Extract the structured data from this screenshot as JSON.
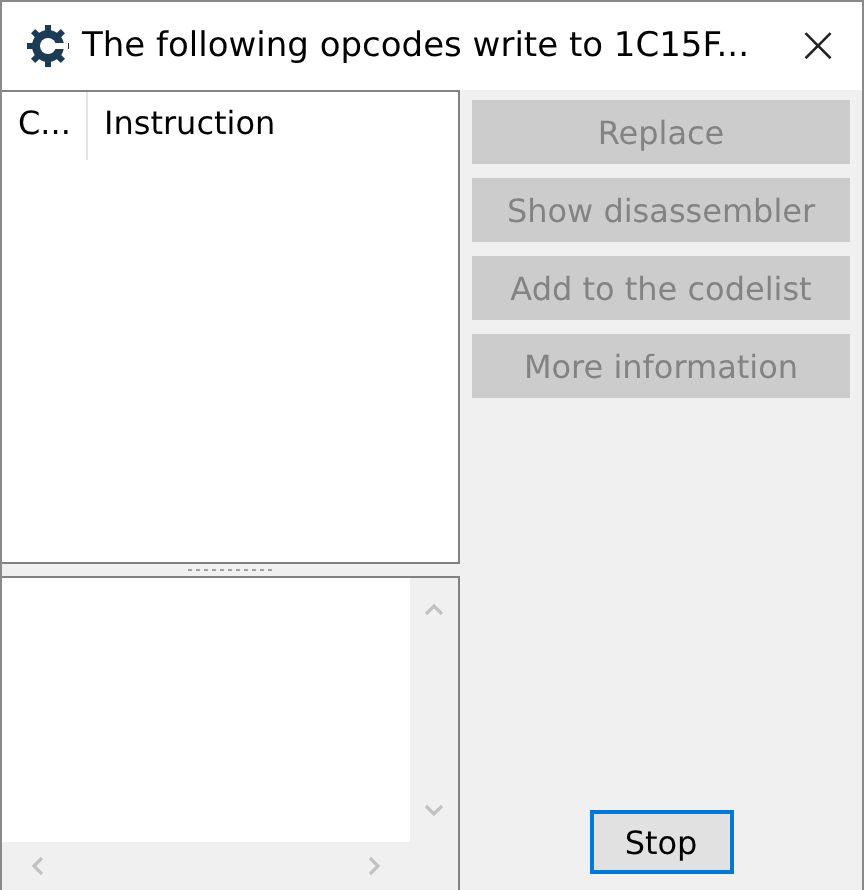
{
  "window": {
    "title": "The following opcodes write to 1C15F...",
    "close": "×"
  },
  "table": {
    "columns": [
      "C...",
      "Instruction"
    ]
  },
  "buttons": [
    {
      "label": "Replace",
      "disabled": true
    },
    {
      "label": "Show disassembler",
      "disabled": true
    },
    {
      "label": "Add to the codelist",
      "disabled": true
    },
    {
      "label": "More information",
      "disabled": true
    }
  ],
  "stop": {
    "label": "Stop",
    "disabled": false
  }
}
